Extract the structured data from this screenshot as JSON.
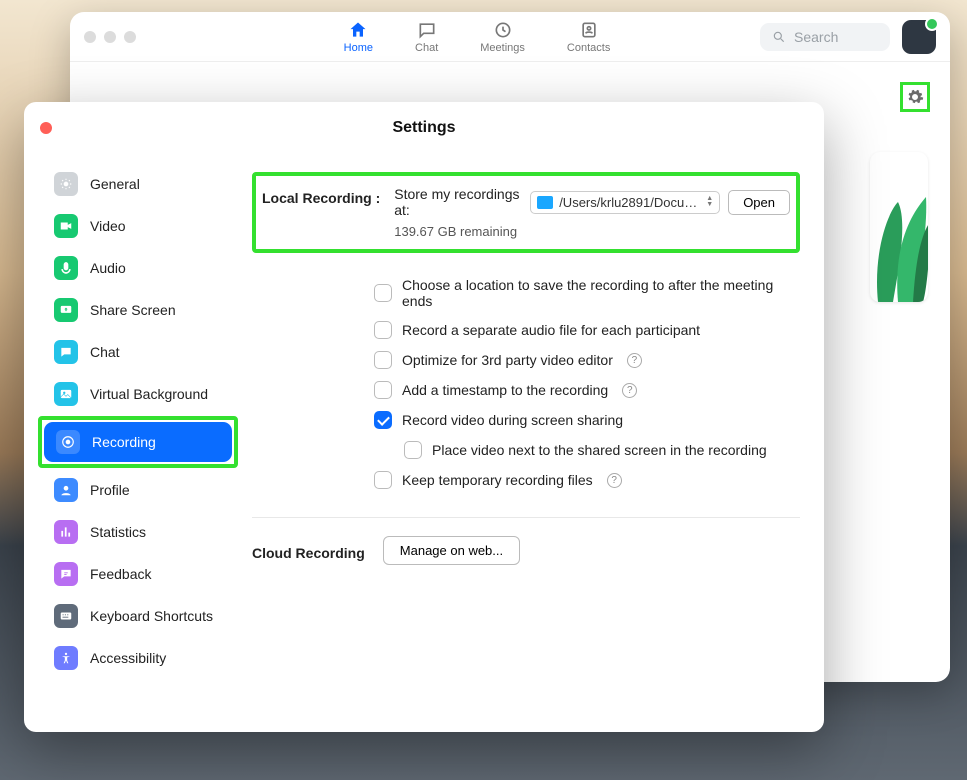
{
  "main": {
    "nav": {
      "home": "Home",
      "chat": "Chat",
      "meetings": "Meetings",
      "contacts": "Contacts"
    },
    "search_placeholder": "Search"
  },
  "settings": {
    "title": "Settings",
    "sidebar": [
      {
        "key": "general",
        "label": "General",
        "color": "#d0d4d8"
      },
      {
        "key": "video",
        "label": "Video",
        "color": "#17c971"
      },
      {
        "key": "audio",
        "label": "Audio",
        "color": "#17c971"
      },
      {
        "key": "share-screen",
        "label": "Share Screen",
        "color": "#17c971"
      },
      {
        "key": "chat",
        "label": "Chat",
        "color": "#23c3e8"
      },
      {
        "key": "virtual-bg",
        "label": "Virtual Background",
        "color": "#23c3e8"
      },
      {
        "key": "recording",
        "label": "Recording",
        "color": "#0a6cff"
      },
      {
        "key": "profile",
        "label": "Profile",
        "color": "#3d8bff"
      },
      {
        "key": "statistics",
        "label": "Statistics",
        "color": "#b86ef2"
      },
      {
        "key": "feedback",
        "label": "Feedback",
        "color": "#b86ef2"
      },
      {
        "key": "shortcuts",
        "label": "Keyboard Shortcuts",
        "color": "#5f6b7a"
      },
      {
        "key": "accessibility",
        "label": "Accessibility",
        "color": "#6f7cff"
      }
    ],
    "local": {
      "label": "Local Recording :",
      "store_label": "Store my recordings at:",
      "path": "/Users/krlu2891/Docum…",
      "open": "Open",
      "remaining": "139.67 GB remaining"
    },
    "options": [
      {
        "text": "Choose a location to save the recording to after the meeting ends",
        "checked": false,
        "help": false
      },
      {
        "text": "Record a separate audio file for each participant",
        "checked": false,
        "help": false
      },
      {
        "text": "Optimize for 3rd party video editor",
        "checked": false,
        "help": true
      },
      {
        "text": "Add a timestamp to the recording",
        "checked": false,
        "help": true
      },
      {
        "text": "Record video during screen sharing",
        "checked": true,
        "help": false
      },
      {
        "text": "Place video next to the shared screen in the recording",
        "checked": false,
        "help": false,
        "sub": true
      },
      {
        "text": "Keep temporary recording files",
        "checked": false,
        "help": true
      }
    ],
    "cloud": {
      "label": "Cloud Recording",
      "button": "Manage on web..."
    }
  }
}
